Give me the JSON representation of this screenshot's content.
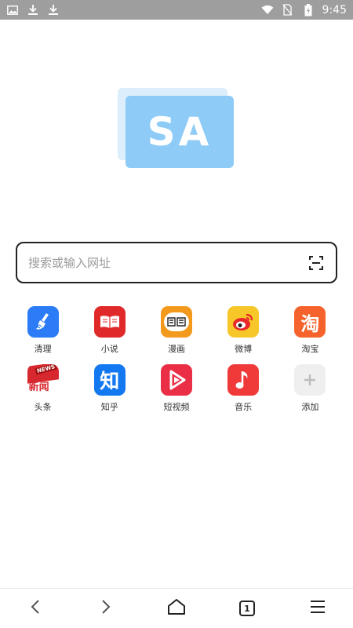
{
  "status_bar": {
    "time": "9:45",
    "left_icons": [
      "image-icon",
      "download-icon",
      "download-icon"
    ],
    "right_icons": [
      "wifi-icon",
      "no-sim-icon",
      "battery-charging-icon"
    ]
  },
  "logo": {
    "text": "SA"
  },
  "search": {
    "placeholder": "搜索或输入网址",
    "scan_icon": "scan-icon"
  },
  "shortcuts": [
    {
      "label": "清理",
      "icon": "broom-icon",
      "color": "#2b7cf6"
    },
    {
      "label": "小说",
      "icon": "book-icon",
      "color": "#e02a2a"
    },
    {
      "label": "漫画",
      "icon": "comic-icon",
      "color": "#f39a1d"
    },
    {
      "label": "微博",
      "icon": "weibo-icon",
      "color": "#f7c628"
    },
    {
      "label": "淘宝",
      "icon": "taobao-icon",
      "glyph": "淘",
      "color": "#f5622b"
    },
    {
      "label": "头条",
      "icon": "news-icon",
      "glyph": "新闻",
      "badge": "NEWS",
      "color": "#d8282f"
    },
    {
      "label": "知乎",
      "icon": "zhihu-icon",
      "glyph": "知",
      "color": "#1478f0"
    },
    {
      "label": "短视频",
      "icon": "video-icon",
      "color": "#ea2e45"
    },
    {
      "label": "音乐",
      "icon": "music-icon",
      "color": "#f03a3a"
    },
    {
      "label": "添加",
      "icon": "plus-icon",
      "color": "#efefef"
    }
  ],
  "bottom_nav": {
    "tab_count": "1",
    "items": [
      "back-icon",
      "forward-icon",
      "home-icon",
      "tabs-icon",
      "menu-icon"
    ]
  }
}
